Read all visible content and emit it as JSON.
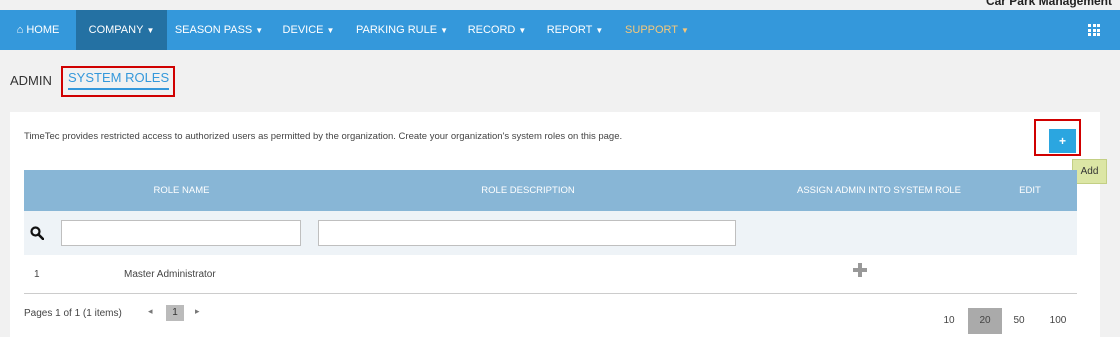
{
  "app": {
    "title": "Car Park Management"
  },
  "nav": {
    "items": [
      {
        "label": "⌂ HOME"
      },
      {
        "label": "COMPANY"
      },
      {
        "label": "SEASON PASS"
      },
      {
        "label": "DEVICE"
      },
      {
        "label": "PARKING RULE"
      },
      {
        "label": "RECORD"
      },
      {
        "label": "REPORT"
      },
      {
        "label": "SUPPORT"
      }
    ],
    "active": "COMPANY",
    "menu_icon": "grid-icon"
  },
  "subnav": {
    "admin": "ADMIN",
    "roles": "SYSTEM ROLES"
  },
  "page": {
    "intro": "TimeTec provides restricted access to authorized users as permitted by the organization. Create your organization's system roles on this page.",
    "add_button": "+",
    "add_tooltip": "Add"
  },
  "table": {
    "headers": [
      "ROLE NAME",
      "ROLE DESCRIPTION",
      "ASSIGN ADMIN INTO SYSTEM ROLE",
      "EDIT"
    ],
    "filter": {
      "name_value": "",
      "description_value": ""
    },
    "rows": [
      {
        "index": "1",
        "role_name": "Master Administrator",
        "role_description": "",
        "assign_icon": "plus-icon"
      }
    ]
  },
  "pagination": {
    "info": "Pages 1 of 1 (1 items)",
    "current_page": "1",
    "prev": "◂",
    "next": "▸",
    "page_sizes": [
      "10",
      "20",
      "50",
      "100"
    ],
    "active_page_size": "20"
  },
  "colors": {
    "nav": "#3498db",
    "nav_active": "#2471a3",
    "header": "#88b6d6",
    "accent": "#2ba6e0",
    "highlight": "#d00000"
  }
}
